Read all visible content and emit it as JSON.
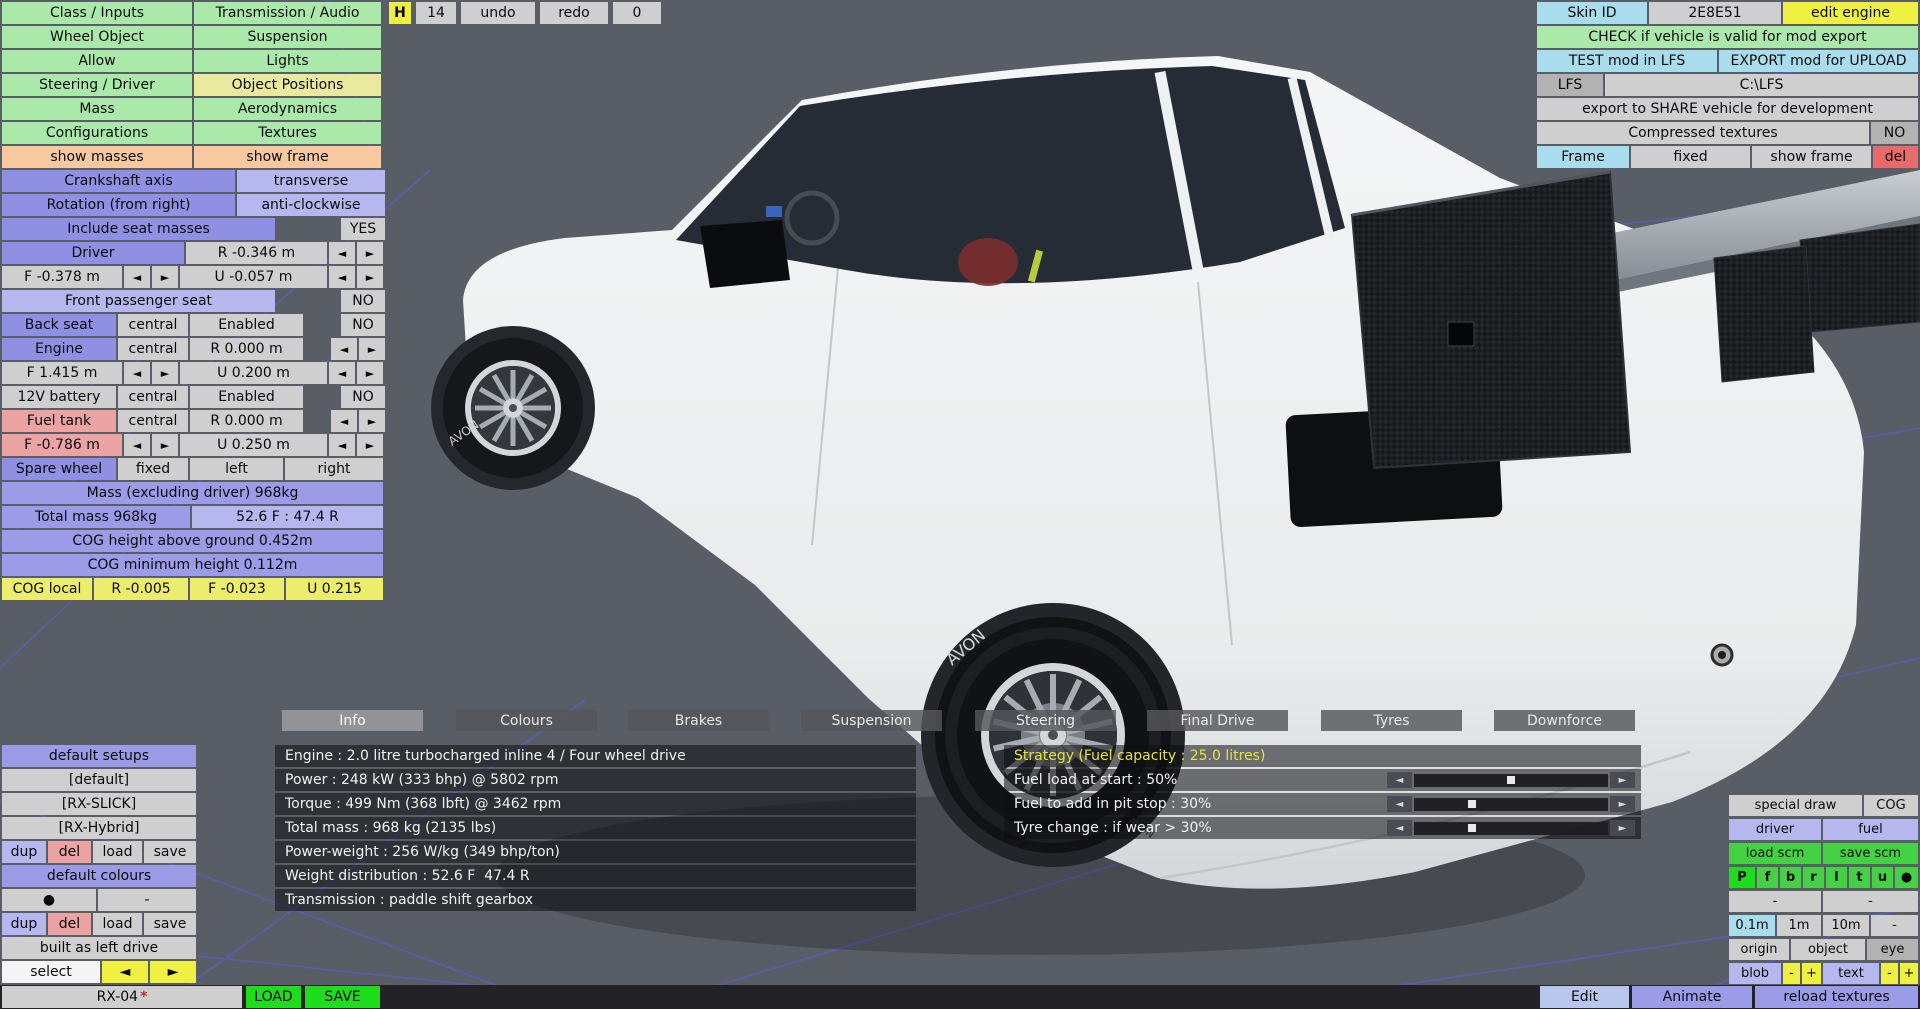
{
  "glyphs": {
    "left": "◄",
    "right": "►",
    "dot": "●",
    "dash": "-",
    "minus": "-",
    "plus": "+"
  },
  "menu": {
    "class_inputs": "Class / Inputs",
    "transmission_audio": "Transmission / Audio",
    "wheel_object": "Wheel Object",
    "suspension": "Suspension",
    "allow": "Allow",
    "lights": "Lights",
    "steering_driver": "Steering / Driver",
    "object_positions": "Object Positions",
    "mass": "Mass",
    "aerodynamics": "Aerodynamics",
    "configurations": "Configurations",
    "textures": "Textures",
    "show_masses": "show masses",
    "show_frame": "show frame"
  },
  "history": {
    "h": "H",
    "count": "14",
    "undo": "undo",
    "redo": "redo",
    "zero": "0"
  },
  "positions": {
    "crankshaft_label": "Crankshaft axis",
    "crankshaft_value": "transverse",
    "rotation_label": "Rotation (from right)",
    "rotation_value": "anti-clockwise",
    "seat_masses_label": "Include seat masses",
    "seat_masses_value": "YES",
    "driver_label": "Driver",
    "driver_r": "R -0.346 m",
    "driver_f": "F -0.378 m",
    "driver_u": "U -0.057 m",
    "front_passenger_label": "Front passenger seat",
    "front_passenger_value": "NO",
    "back_seat_label": "Back seat",
    "back_seat_pos": "central",
    "back_seat_state": "Enabled",
    "back_seat_value": "NO",
    "engine_label": "Engine",
    "engine_pos": "central",
    "engine_r": "R 0.000 m",
    "engine_f": "F 1.415 m",
    "engine_u": "U 0.200 m",
    "battery_label": "12V battery",
    "battery_pos": "central",
    "battery_state": "Enabled",
    "battery_value": "NO",
    "fuel_label": "Fuel tank",
    "fuel_pos": "central",
    "fuel_r": "R 0.000 m",
    "fuel_f": "F -0.786 m",
    "fuel_u": "U 0.250 m",
    "spare_label": "Spare wheel",
    "spare_mode": "fixed",
    "spare_left": "left",
    "spare_right": "right",
    "mass_excl": "Mass (excluding driver) 968kg",
    "total_mass": "Total mass 968kg",
    "mass_split": "52.6 F : 47.4 R",
    "cog_height": "COG height above ground 0.452m",
    "cog_min": "COG minimum height 0.112m",
    "cog_local_label": "COG local",
    "cog_r": "R -0.005",
    "cog_f": "F -0.023",
    "cog_u": "U 0.215"
  },
  "export_panel": {
    "skin_label": "Skin ID",
    "skin_value": "2E8E51",
    "edit_engine": "edit engine",
    "check": "CHECK if vehicle is valid for mod export",
    "test": "TEST mod in LFS",
    "upload": "EXPORT mod for UPLOAD",
    "lfs": "LFS",
    "path": "C:\\LFS",
    "share": "export to SHARE vehicle for development",
    "compressed": "Compressed textures",
    "compressed_value": "NO",
    "frame": "Frame",
    "frame_fixed": "fixed",
    "frame_show": "show frame",
    "frame_del": "del"
  },
  "tabs": [
    "Info",
    "Colours",
    "Brakes",
    "Suspension",
    "Steering",
    "Final Drive",
    "Tyres",
    "Downforce"
  ],
  "info_lines": [
    "Engine : 2.0 litre turbocharged inline 4 / Four wheel drive",
    "Power : 248 kW (333 bhp) @ 5802 rpm",
    "Torque : 499 Nm (368 lbft) @ 3462 rpm",
    "Total mass : 968 kg (2135 lbs)",
    "Power-weight : 256 W/kg (349 bhp/ton)",
    "Weight distribution : 52.6 F  47.4 R",
    "Transmission : paddle shift gearbox"
  ],
  "strategy": {
    "title": "Strategy (Fuel capacity : 25.0 litres)",
    "rows": [
      {
        "label": "Fuel load at start : 50%",
        "percent": 50
      },
      {
        "label": "Fuel to add in pit stop : 30%",
        "percent": 30
      },
      {
        "label": "Tyre change : if wear > 30%",
        "percent": 30
      }
    ]
  },
  "setups": {
    "default_setups": "default setups",
    "items": [
      "[default]",
      "[RX-SLICK]",
      "[RX-Hybrid]"
    ],
    "dup": "dup",
    "del": "del",
    "load": "load",
    "save": "save",
    "default_colours": "default colours",
    "built": "built as left drive",
    "select": "select"
  },
  "tools": {
    "special_draw": "special draw",
    "cog": "COG",
    "driver": "driver",
    "fuel": "fuel",
    "load_scm": "load scm",
    "save_scm": "save scm",
    "letters": [
      "P",
      "f",
      "b",
      "r",
      "l",
      "t",
      "u",
      "●"
    ],
    "steps": [
      "0.1m",
      "1m",
      "10m",
      "-"
    ],
    "origin": "origin",
    "object": "object",
    "eye": "eye",
    "blob": "blob",
    "text": "text"
  },
  "bottom_bar": {
    "model": "RX-04",
    "dirty": "*",
    "load": "LOAD",
    "save": "SAVE",
    "edit": "Edit",
    "animate": "Animate",
    "reload": "reload textures"
  },
  "viewport": {
    "tire_brand": "AVON"
  }
}
